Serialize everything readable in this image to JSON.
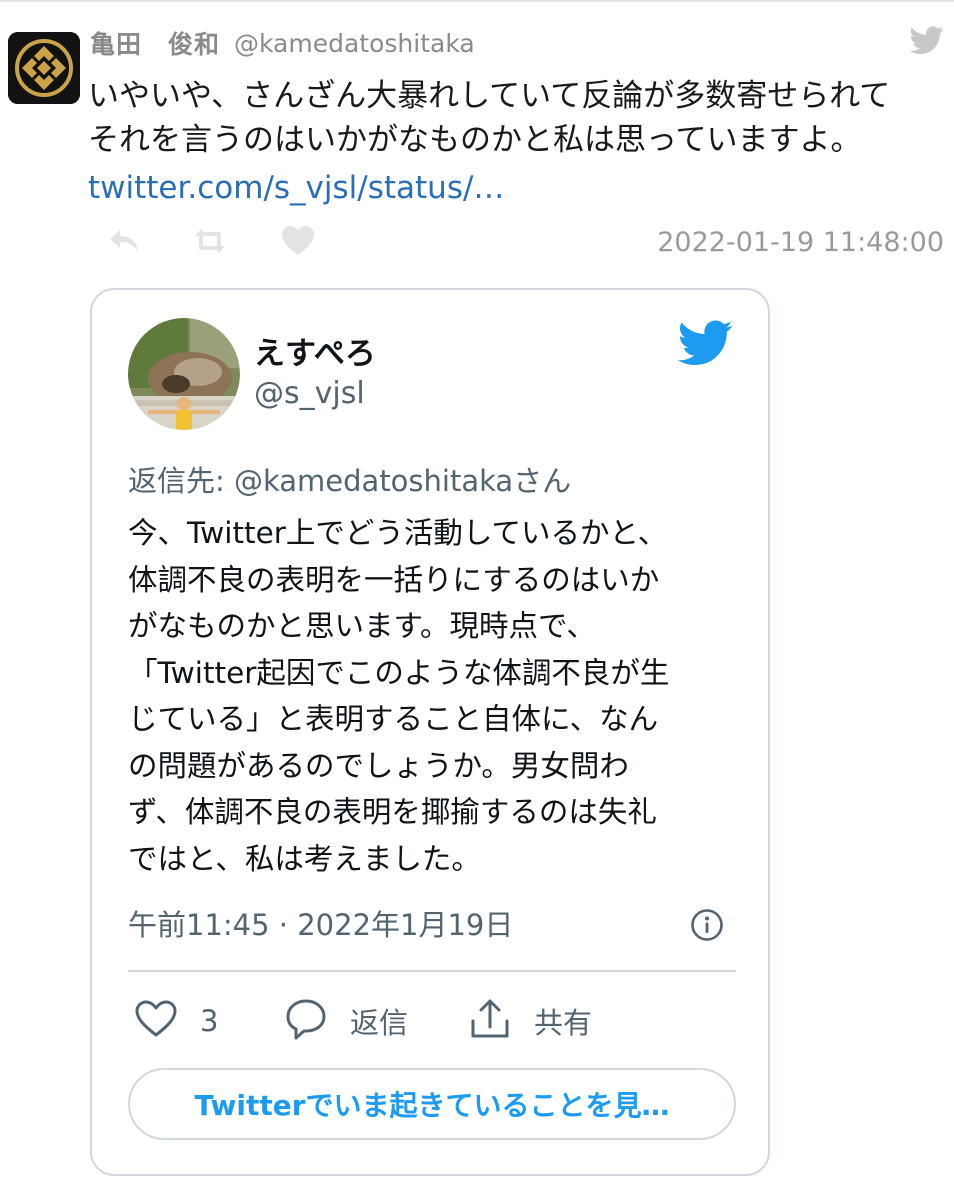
{
  "outer_tweet": {
    "author_name": "亀田　俊和",
    "author_handle": "@kamedatoshitaka",
    "text_lines": [
      "いやいや、さんざん大暴れしていて反論が多数寄せられて",
      "それを言うのはいかがなものかと私は思っていますよ。"
    ],
    "link": "twitter.com/s_vjsl/status/…",
    "timestamp": "2022-01-19 11:48:00",
    "icons": {
      "bird": "twitter-bird-icon",
      "reply": "reply-icon",
      "retweet": "retweet-icon",
      "like": "heart-icon"
    }
  },
  "embedded_tweet": {
    "name": "えすぺろ",
    "handle": "@s_vjsl",
    "reply_to": "返信先: @kamedatoshitakaさん",
    "body_lines": [
      "今、Twitter上でどう活動しているかと、",
      "体調不良の表明を一括りにするのはいか",
      "がなものかと思います。現時点で、",
      "「Twitter起因でこのような体調不良が生",
      "じている」と表明すること自体に、なん",
      "の問題があるのでしょうか。男女問わ",
      "ず、体調不良の表明を揶揄するのは失礼",
      "ではと、私は考えました。"
    ],
    "time": "午前11:45 · 2022年1月19日",
    "like_count": "3",
    "reply_label": "返信",
    "share_label": "共有",
    "cta_label": "Twitterでいま起きていることを見…",
    "colors": {
      "accent": "#1d9bf0",
      "link": "#2a6db8",
      "muted": "#536471"
    }
  }
}
